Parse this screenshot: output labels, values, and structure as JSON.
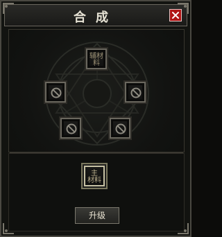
{
  "window": {
    "title": "合成"
  },
  "buttons": {
    "close_label": "",
    "upgrade_label": "升级"
  },
  "slots": {
    "auxiliary": {
      "label_line1": "辅材",
      "label_line2": "料"
    },
    "main": {
      "label_line1": "主",
      "label_line2": "材料"
    }
  },
  "icons": {
    "close": "x-icon",
    "empty_slot": "prohibited-icon"
  },
  "colors": {
    "close_red": "#b01616",
    "frame": "#6a675e"
  }
}
